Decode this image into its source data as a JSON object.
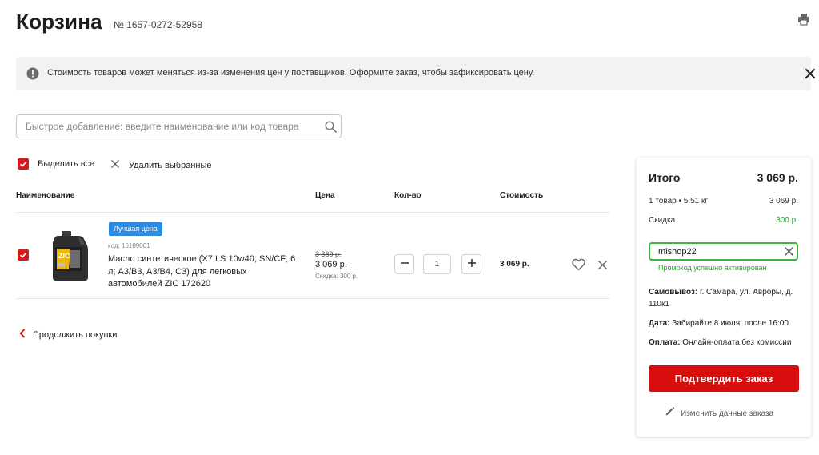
{
  "header": {
    "title": "Корзина",
    "order_number": "№ 1657-0272-52958",
    "print_icon": "printer-icon"
  },
  "notice": {
    "icon": "info-circle-icon",
    "text": "Стоимость товаров может меняться из-за изменения цен у поставщиков. Оформите заказ, чтобы зафиксировать цену.",
    "close_icon": "close-icon"
  },
  "quick_add": {
    "placeholder": "Быстрое добавление: введите наименование или код товара",
    "icon": "search-icon"
  },
  "bulk_actions": {
    "select_all": "Выделить все",
    "delete_selected": "Удалить выбранные"
  },
  "table": {
    "headers": {
      "name": "Наименование",
      "price": "Цена",
      "qty": "Кол-во",
      "total": "Стоимость"
    },
    "items": [
      {
        "checked": true,
        "badge": "Лучшая цена",
        "code": "код: 16189001",
        "name": "Масло синтетическое (X7 LS 10w40; SN/CF; 6 л; A3/B3, A3/B4, C3) для легковых автомобилей ZIC 172620",
        "old_price": "3 369 р.",
        "price": "3 069 р.",
        "discount": "Скидка: 300 р.",
        "qty": "1",
        "total": "3 069 р."
      }
    ]
  },
  "continue_shopping": "Продолжить покупки",
  "summary": {
    "title": "Итого",
    "total": "3 069 р.",
    "items_line": "1 товар • 5.51 кг",
    "items_value": "3 069 р.",
    "discount_label": "Скидка",
    "discount_value": "300 р.",
    "promo_code": "mishop22",
    "promo_message": "Промокод успешно активирован",
    "pickup_label": "Самовывоз:",
    "pickup_value": " г. Самара, ул. Авроры, д. 110к1",
    "date_label": "Дата:",
    "date_value": " Забирайте 8 июля, после 16:00",
    "payment_label": "Оплата:",
    "payment_value": " Онлайн-оплата без комиссии",
    "confirm_button": "Подтвердить заказ",
    "edit_link": "Изменить данные заказа"
  },
  "colors": {
    "accent_red": "#d80d0d",
    "success_green": "#2ea12e",
    "badge_blue": "#2a8be0"
  }
}
